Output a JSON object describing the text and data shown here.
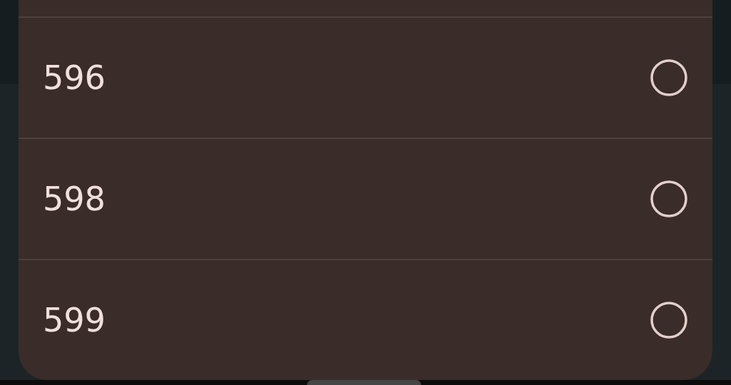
{
  "options": [
    {
      "label": "596",
      "selected": false
    },
    {
      "label": "598",
      "selected": false
    },
    {
      "label": "599",
      "selected": false
    }
  ]
}
